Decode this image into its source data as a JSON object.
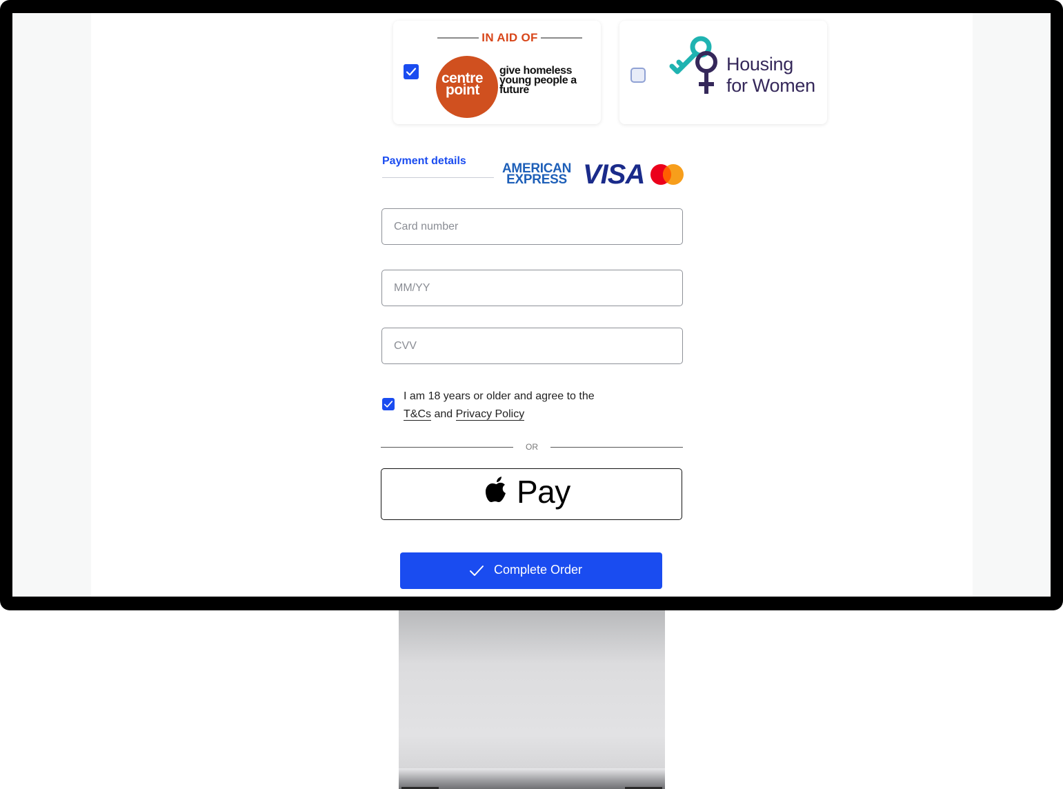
{
  "charities": [
    {
      "tagline_top": "IN AID OF",
      "logo_line1": "centre",
      "logo_line2": "point",
      "logo_tagline": "give homeless young people a future",
      "checked": true
    },
    {
      "name_line1": "Housing",
      "name_line2": "for Women",
      "checked": false
    }
  ],
  "payment": {
    "tab_label": "Payment details",
    "brands": {
      "amex_line1": "AMERICAN",
      "amex_line2": "EXPRESS",
      "visa": "VISA"
    },
    "card_number_placeholder": "Card number",
    "expiry_placeholder": "MM/YY",
    "cvv_placeholder": "CVV"
  },
  "agreement": {
    "text_before": "I am 18 years or older and agree to the",
    "tcs_link": "T&Cs",
    "and": "and",
    "privacy_link": "Privacy Policy",
    "checked": true
  },
  "divider_label": "OR",
  "apple_pay_label": "Pay",
  "complete_button_label": "Complete Order",
  "colors": {
    "accent": "#1a4cf0",
    "centrepoint_orange": "#d0501f",
    "housing_purple": "#35285a",
    "housing_teal": "#1fb3b1"
  }
}
